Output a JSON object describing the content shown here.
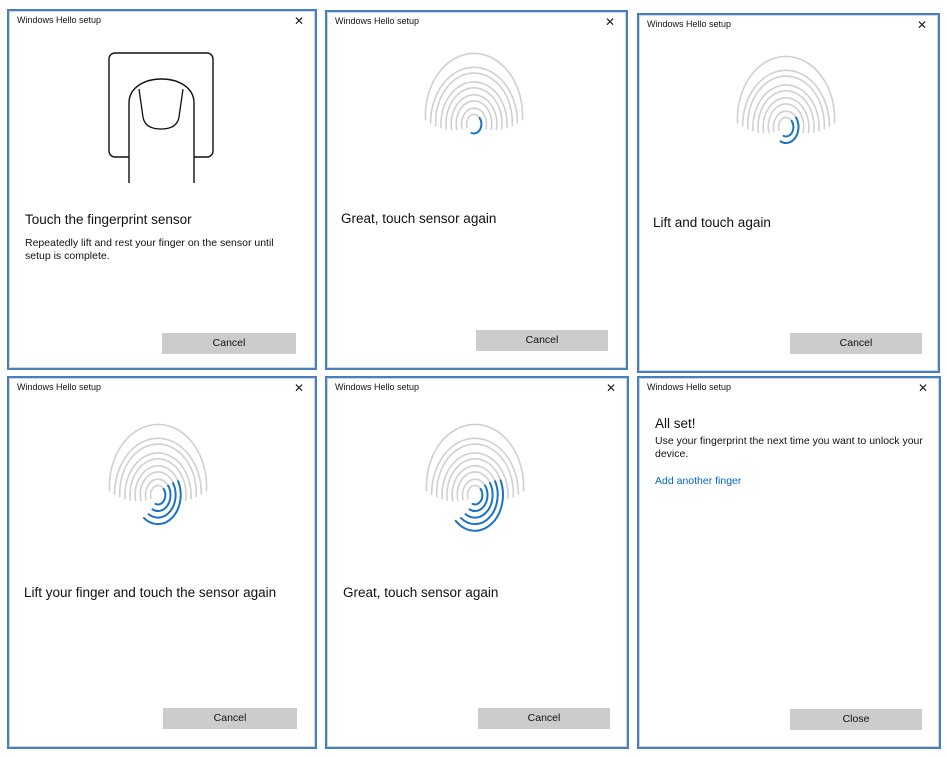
{
  "window_title": "Windows Hello setup",
  "close_glyph": "✕",
  "panels": [
    {
      "heading": "Touch the fingerprint sensor",
      "body": "Repeatedly lift and rest your finger on the sensor until setup is complete.",
      "button": "Cancel",
      "illustration": "finger-on-sensor-icon",
      "scan_progress": 0
    },
    {
      "heading": "Great, touch sensor again",
      "button": "Cancel",
      "illustration": "fingerprint-icon",
      "scan_progress": 0.2
    },
    {
      "heading": "Lift and touch again",
      "button": "Cancel",
      "illustration": "fingerprint-icon",
      "scan_progress": 0.4
    },
    {
      "heading": "Lift your finger and touch the sensor again",
      "button": "Cancel",
      "illustration": "fingerprint-icon",
      "scan_progress": 0.6
    },
    {
      "heading": "Great, touch sensor again",
      "button": "Cancel",
      "illustration": "fingerprint-icon",
      "scan_progress": 0.8
    },
    {
      "heading": "All set!",
      "body": "Use your fingerprint the next time you want to unlock your device.",
      "link": "Add another finger",
      "button": "Close"
    }
  ],
  "colors": {
    "accent": "#0067c0",
    "ridge_blue": "#1a73c7",
    "ridge_gray": "#d0d0d0",
    "button_bg": "#cccccc",
    "border": "#4a7ebb"
  }
}
